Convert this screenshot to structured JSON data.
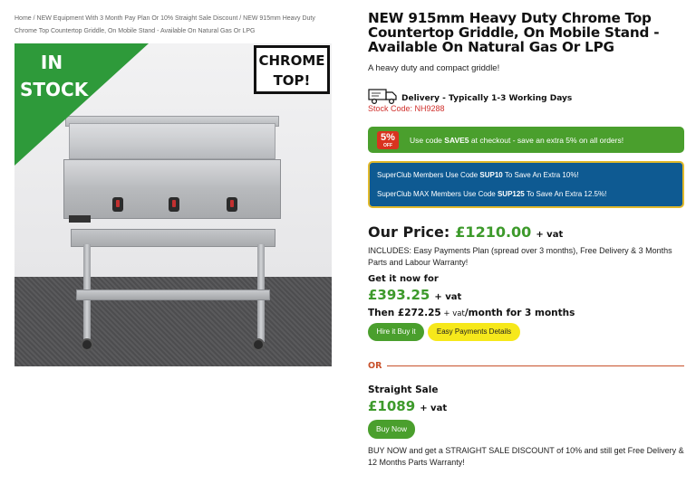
{
  "breadcrumb": {
    "home": "Home",
    "sep": " / ",
    "category": "NEW Equipment With 3 Month Pay Plan Or 10% Straight Sale Discount",
    "current": "NEW 915mm Heavy Duty Chrome Top Countertop Griddle, On Mobile Stand - Available On Natural Gas Or LPG"
  },
  "image": {
    "stock_badge": "IN STOCK",
    "chrome_badge": "CHROME TOP!"
  },
  "product": {
    "title": "NEW 915mm Heavy Duty Chrome Top Countertop Griddle, On Mobile Stand - Available On Natural Gas Or LPG",
    "subtitle": "A heavy duty and compact griddle!",
    "delivery": "Delivery - Typically 1-3 Working Days",
    "stock_code": "Stock Code: NH9288"
  },
  "promo": {
    "badge_num": "5%",
    "badge_off": "OFF",
    "text_pre": "Use code ",
    "code": "SAVE5",
    "text_post": " at checkout - save an extra 5% on all orders!"
  },
  "superclub": {
    "line1_pre": "SuperClub Members Use Code ",
    "line1_code": "SUP10",
    "line1_post": " To Save An Extra 10%!",
    "line2_pre": "SuperClub MAX Members Use Code ",
    "line2_code": "SUP125",
    "line2_post": " To Save An Extra 12.5%!"
  },
  "pricing": {
    "our_price_label": "Our Price:",
    "our_price": "£1210.00",
    "vat": "+ vat",
    "includes": "INCLUDES: Easy Payments Plan (spread over 3 months), Free Delivery & 3 Months Parts and Labour Warranty!",
    "get_now_label": "Get it now for",
    "deposit": "£393.25",
    "then_label": "Then £272.25",
    "then_small": " + vat",
    "then_suffix": "/month for 3 months",
    "hire_button": "Hire it Buy it",
    "easy_button": "Easy Payments Details",
    "or_label": "OR",
    "straight_label": "Straight Sale",
    "straight_price": "£1089",
    "buy_button": "Buy Now",
    "buy_now_text": "BUY NOW and get a STRAIGHT SALE DISCOUNT of 10% and still get Free Delivery & 12 Months Parts Warranty!"
  },
  "colors": {
    "green": "#4a9f2d",
    "price_green": "#3d9a2b",
    "blue": "#0e5a92",
    "gold": "#e1b92b",
    "yellow": "#f6e81b",
    "red": "#d0312d",
    "or_orange": "#c8512b"
  }
}
